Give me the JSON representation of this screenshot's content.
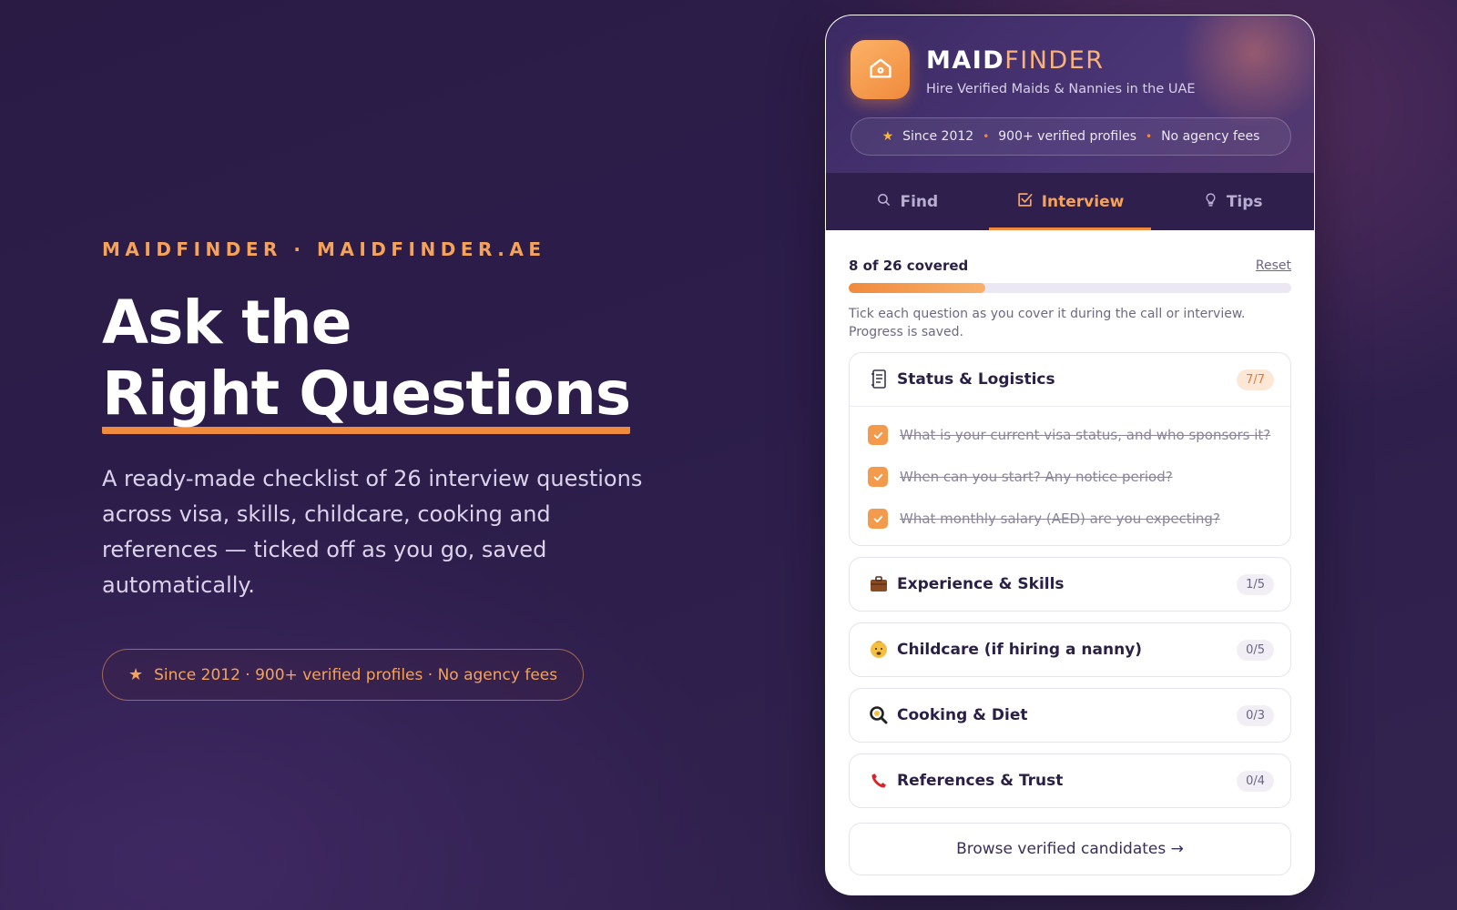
{
  "hero": {
    "eyebrow": "MAIDFINDER · MAIDFINDER.AE",
    "headline_line1": "Ask the",
    "headline_line2": "Right Questions",
    "description": "A ready-made checklist of 26 interview questions across visa, skills, childcare, cooking and references — ticked off as you go, saved automatically.",
    "pill_text": "Since 2012 · 900+ verified profiles · No agency fees",
    "pill_icon": "star-icon"
  },
  "app": {
    "brand_part1": "MAID",
    "brand_part2": "FINDER",
    "tagline": "Hire Verified Maids & Nannies in the UAE",
    "logo_icon": "house-icon",
    "trust": [
      "Since 2012",
      "900+ verified profiles",
      "No agency fees"
    ],
    "tabs": [
      {
        "label": "Find",
        "icon": "search-icon",
        "active": false
      },
      {
        "label": "Interview",
        "icon": "checkbox-icon",
        "active": true
      },
      {
        "label": "Tips",
        "icon": "lightbulb-icon",
        "active": false
      }
    ],
    "progress": {
      "label": "8 of 26 covered",
      "covered": 8,
      "total": 26,
      "reset_label": "Reset",
      "hint": "Tick each question as you cover it during the call or interview. Progress is saved."
    },
    "sections": [
      {
        "title": "Status & Logistics",
        "icon": "document-icon",
        "count": "7/7",
        "complete": true,
        "expanded": true,
        "questions": [
          "What is your current visa status, and who sponsors it?",
          "When can you start? Any notice period?",
          "What monthly salary (AED) are you expecting?"
        ]
      },
      {
        "title": "Experience & Skills",
        "icon": "briefcase-icon",
        "count": "1/5",
        "complete": false,
        "expanded": false
      },
      {
        "title": "Childcare (if hiring a nanny)",
        "icon": "baby-icon",
        "count": "0/5",
        "complete": false,
        "expanded": false
      },
      {
        "title": "Cooking & Diet",
        "icon": "frying-pan-icon",
        "count": "0/3",
        "complete": false,
        "expanded": false
      },
      {
        "title": "References & Trust",
        "icon": "phone-icon",
        "count": "0/4",
        "complete": false,
        "expanded": false
      }
    ],
    "browse_label": "Browse verified candidates →",
    "colors": {
      "accent": "#f08a3c",
      "dark": "#2e1f4c",
      "text": "#2a1f45"
    }
  }
}
